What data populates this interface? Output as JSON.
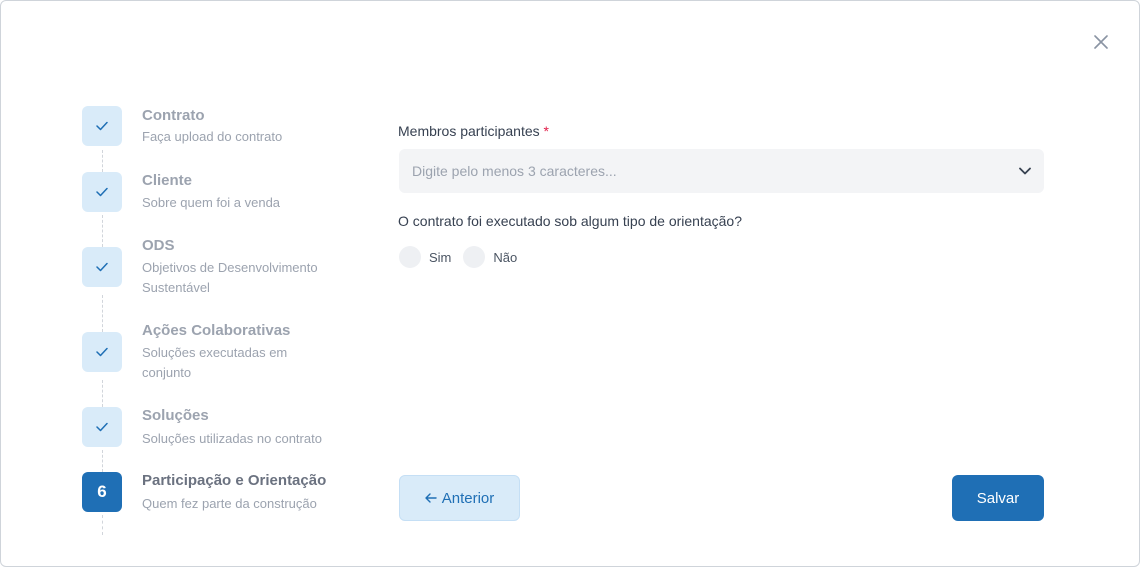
{
  "steps": [
    {
      "title": "Contrato",
      "subtitle": "Faça upload do contrato",
      "status": "done"
    },
    {
      "title": "Cliente",
      "subtitle": "Sobre quem foi a venda",
      "status": "done"
    },
    {
      "title": "ODS",
      "subtitle": "Objetivos de Desenvolvimento Sustentável",
      "status": "done"
    },
    {
      "title": "Ações Colaborativas",
      "subtitle": "Soluções executadas em conjunto",
      "status": "done"
    },
    {
      "title": "Soluções",
      "subtitle": "Soluções utilizadas no contrato",
      "status": "done"
    },
    {
      "title": "Participação e Orientação",
      "subtitle": "Quem fez parte da construção",
      "status": "active",
      "number": "6"
    }
  ],
  "form": {
    "members_label": "Membros participantes",
    "required_mark": "*",
    "members_placeholder": "Digite pelo menos 3 caracteres...",
    "orientation_question": "O contrato foi executado sob algum tipo de orientação?",
    "option_yes": "Sim",
    "option_no": "Não"
  },
  "actions": {
    "prev_label": "Anterior",
    "save_label": "Salvar"
  },
  "colors": {
    "primary": "#1f6fb5",
    "step_done_bg": "#d9ebf9",
    "required": "#e11d48"
  }
}
